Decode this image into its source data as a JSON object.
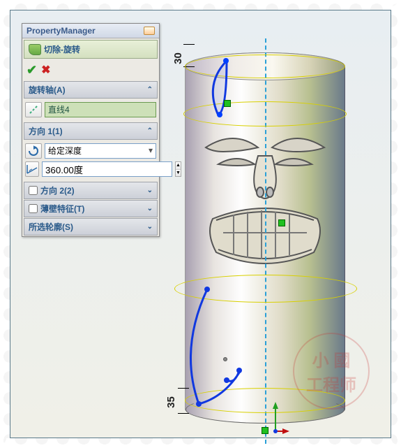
{
  "panel": {
    "title": "PropertyManager",
    "feature_name": "切除-旋转",
    "sections": {
      "axis": {
        "title": "旋转轴(A)",
        "value": "直线4"
      },
      "dir1": {
        "title": "方向 1(1)",
        "end_condition": "给定深度",
        "angle": "360.00度"
      },
      "dir2": {
        "label": "方向 2(2)"
      },
      "thin": {
        "label": "薄壁特征(T)"
      },
      "contours": {
        "title": "所选轮廓(S)"
      }
    }
  },
  "dimensions": {
    "top": "30",
    "bottom": "35"
  },
  "watermark": {
    "line1": "小  國",
    "line2": "工程师"
  }
}
